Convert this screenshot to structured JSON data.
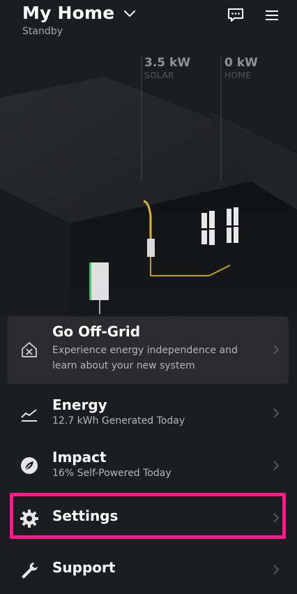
{
  "header": {
    "title": "My Home",
    "status": "Standby"
  },
  "icons": {
    "title_dropdown": "chevron-down-icon",
    "chat": "chat-bubble-icon",
    "menu": "hamburger-menu-icon"
  },
  "stats": {
    "solar_value": "3.5 kW",
    "solar_label": "SOLAR",
    "home_value": "0 kW",
    "home_label": "HOME"
  },
  "menu": {
    "offgrid": {
      "label": "Go Off-Grid",
      "desc": "Experience energy independence and learn about your new system",
      "icon": "house-offgrid-icon"
    },
    "energy": {
      "label": "Energy",
      "desc": "12.7 kWh Generated Today",
      "icon": "energy-graph-icon"
    },
    "impact": {
      "label": "Impact",
      "desc": "16% Self-Powered Today",
      "icon": "leaf-icon"
    },
    "settings": {
      "label": "Settings",
      "icon": "gear-icon"
    },
    "support": {
      "label": "Support",
      "icon": "wrench-icon"
    }
  },
  "colors": {
    "background": "#1c1d20",
    "highlight": "#ff1a8c",
    "solar_line": "#e5c22a",
    "battery_accent": "#3fbf6a"
  }
}
